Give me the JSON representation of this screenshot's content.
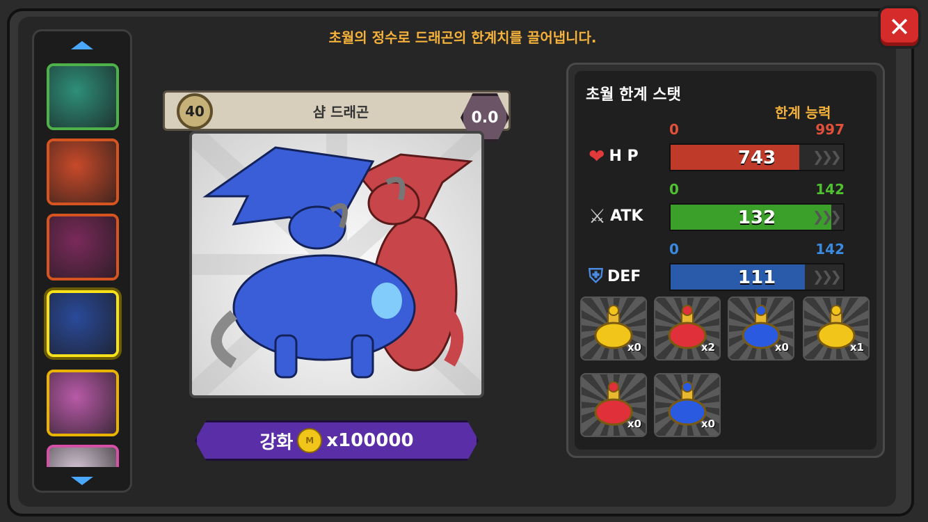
{
  "notice": "초월의 정수로 드래곤의 한계치를 끌어냅니다.",
  "card": {
    "level": "40",
    "name": "샴 드래곤",
    "grade": "0.0",
    "upgrade_label": "강화",
    "upgrade_cost": "x100000",
    "coin_icon": "coin-icon"
  },
  "dragon_list": {
    "slots": [
      {
        "icon": "green-dragon-portrait",
        "color": "#2e8f7a",
        "border": "#4fb14a"
      },
      {
        "icon": "white-red-dragon-portrait",
        "color": "#c84a2a",
        "border": "#d6541f"
      },
      {
        "icon": "red-purple-dragon-portrait",
        "color": "#7a2a5a",
        "border": "#d6541f"
      },
      {
        "icon": "siamese-dragon-portrait",
        "color": "#2a4a9a",
        "border": "#f7e11a",
        "selected": true
      },
      {
        "icon": "pink-triceratops-portrait",
        "color": "#b85aa8",
        "border": "#e8b400"
      },
      {
        "icon": "white-dragon-portrait",
        "color": "#d8c8d8",
        "border": "#d650a8"
      }
    ]
  },
  "stats": {
    "title": "초월 한계 스탯",
    "limit_label": "한계 능력",
    "rows": [
      {
        "key": "hp",
        "label": "H P",
        "icon": "heart-icon",
        "min": "0",
        "max": "997",
        "value": "743",
        "fraction": 0.745,
        "fill": "#c03a2a",
        "min_color": "#e0503a",
        "max_color": "#e0503a"
      },
      {
        "key": "atk",
        "label": "ATK",
        "icon": "crossed-swords-icon",
        "min": "0",
        "max": "142",
        "value": "132",
        "fraction": 0.93,
        "fill": "#3aa02a",
        "min_color": "#4fc030",
        "max_color": "#4fc030"
      },
      {
        "key": "def",
        "label": "DEF",
        "icon": "shield-icon",
        "min": "0",
        "max": "142",
        "value": "111",
        "fraction": 0.78,
        "fill": "#2a5aaa",
        "min_color": "#3a8ae0",
        "max_color": "#3a8ae0"
      }
    ]
  },
  "items": [
    {
      "icon": "gold-potion-icon",
      "count": "x0",
      "color": "#f2c51a"
    },
    {
      "icon": "red-potion-icon",
      "count": "x2",
      "color": "#e0303a"
    },
    {
      "icon": "blue-potion-icon",
      "count": "x0",
      "color": "#2a5ae0"
    },
    {
      "icon": "large-gold-potion-icon",
      "count": "x1",
      "color": "#f2c51a"
    },
    {
      "icon": "large-red-potion-icon",
      "count": "x0",
      "color": "#e0303a"
    },
    {
      "icon": "large-blue-potion-icon",
      "count": "x0",
      "color": "#2a5ae0"
    }
  ]
}
